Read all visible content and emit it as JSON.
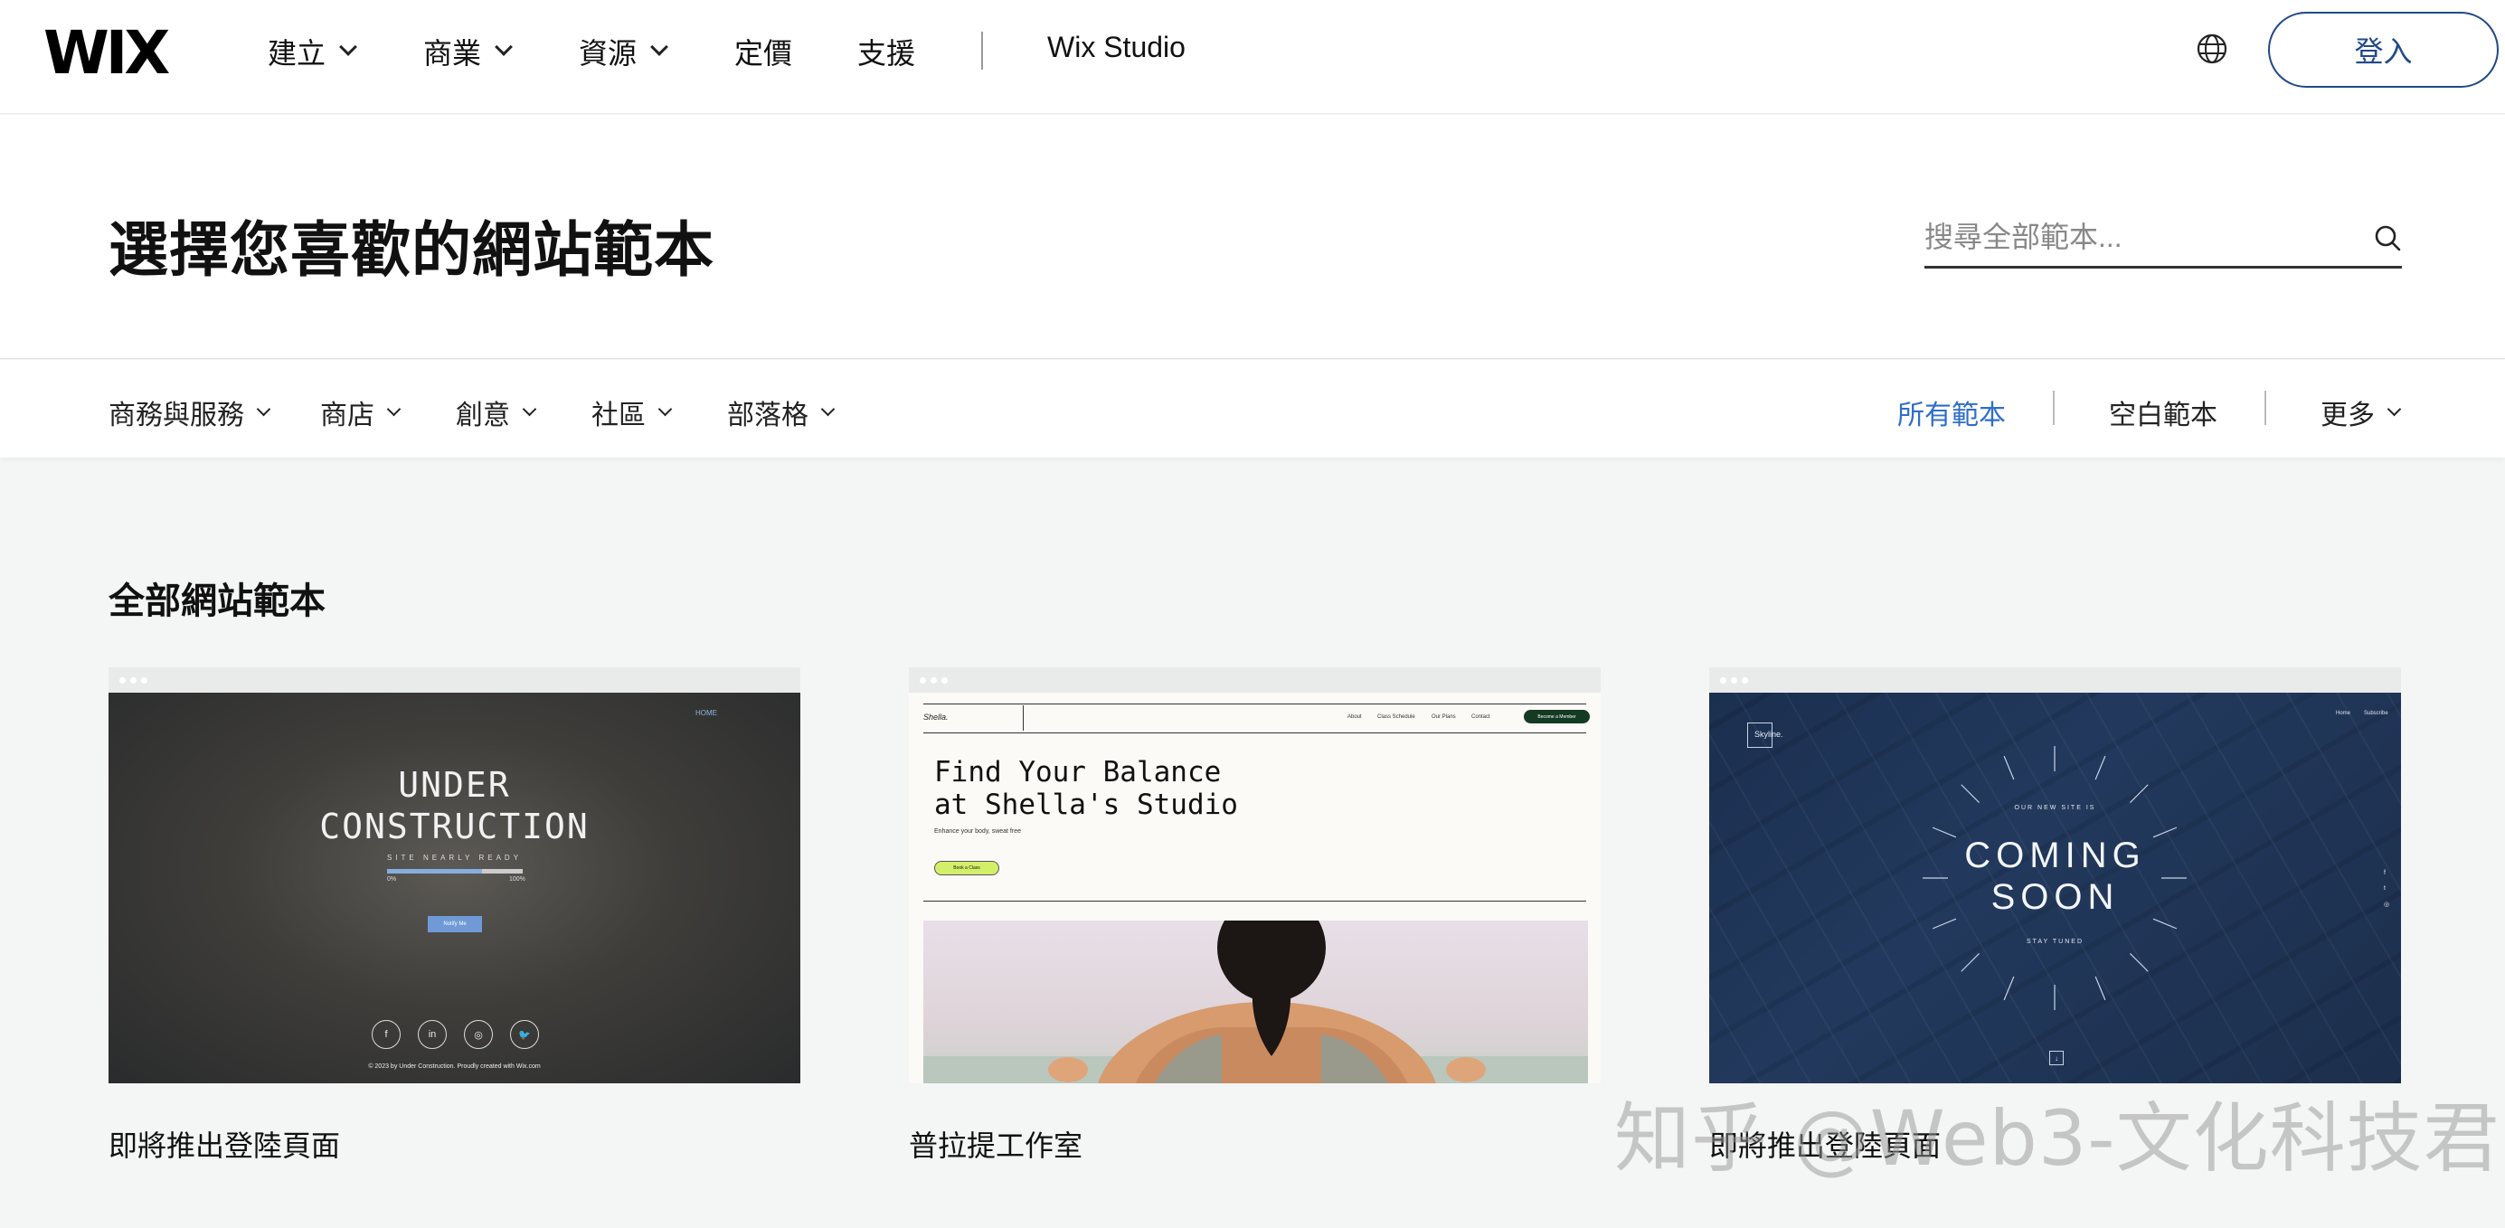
{
  "app": {
    "logo": "WIX"
  },
  "nav": {
    "items": [
      {
        "label": "建立",
        "dropdown": true
      },
      {
        "label": "商業",
        "dropdown": true
      },
      {
        "label": "資源",
        "dropdown": true
      },
      {
        "label": "定價",
        "dropdown": false
      },
      {
        "label": "支援",
        "dropdown": false
      }
    ],
    "studio": "Wix Studio",
    "language_icon": "globe-icon",
    "login": "登入"
  },
  "hero": {
    "title": "選擇您喜歡的網站範本",
    "search_placeholder": "搜尋全部範本...",
    "search_icon": "search-icon"
  },
  "categories": {
    "left": [
      "商務與服務",
      "商店",
      "創意",
      "社區",
      "部落格"
    ],
    "right": {
      "all": "所有範本",
      "blank": "空白範本",
      "more": "更多"
    }
  },
  "section": {
    "title": "全部網站範本"
  },
  "templates": [
    {
      "label": "即將推出登陸頁面",
      "preview": {
        "nav": "HOME",
        "line1": "UNDER",
        "line2": "CONSTRUCTION",
        "sub": "SITE NEARLY READY",
        "progress": 0.7,
        "progress_start": "0%",
        "progress_end": "100%",
        "button": "Notify Me",
        "social": [
          "f",
          "in",
          "◎",
          "🐦"
        ],
        "copyright": "© 2023 by Under Construction. Proudly created with Wix.com"
      }
    },
    {
      "label": "普拉提工作室",
      "preview": {
        "brand": "Shella.",
        "menu": [
          "About",
          "Class Schedule",
          "Our Plans",
          "Contact"
        ],
        "cta": "Become a Member",
        "headline": "Find Your Balance\nat Shella's Studio",
        "tagline": "Enhance your body, sweat free",
        "button": "Book a Class"
      }
    },
    {
      "label": "即將推出登陸頁面",
      "preview": {
        "brand": "Skyline.",
        "menu": [
          "Home",
          "Subscribe"
        ],
        "eyebrow": "OUR NEW SITE IS",
        "line1": "COMING",
        "line2": "SOON",
        "footer": "STAY TUNED",
        "side": [
          "f",
          "t",
          "◎"
        ],
        "down": "↓"
      }
    }
  ],
  "watermark": "知乎 @Web3-文化科技君",
  "colors": {
    "brand_blue": "#1f4a88",
    "active_blue": "#2e6ec9",
    "page_bg": "#f4f5f5"
  }
}
